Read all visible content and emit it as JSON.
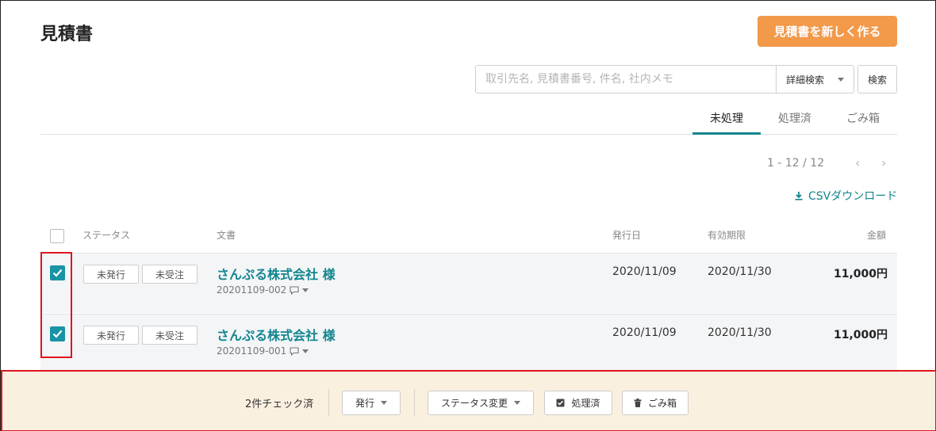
{
  "page": {
    "title": "見積書"
  },
  "toolbar": {
    "new_label": "見積書を新しく作る"
  },
  "search": {
    "placeholder": "取引先名, 見積書番号, 件名, 社内メモ",
    "advanced_label": "詳細検索",
    "button_label": "検索"
  },
  "tabs": [
    {
      "label": "未処理",
      "active": true
    },
    {
      "label": "処理済",
      "active": false
    },
    {
      "label": "ごみ箱",
      "active": false
    }
  ],
  "pagination": {
    "range": "1 - 12 / 12"
  },
  "csv": {
    "label": "CSVダウンロード"
  },
  "table": {
    "headers": {
      "status": "ステータス",
      "document": "文書",
      "issue_date": "発行日",
      "expiry": "有効期限",
      "amount": "金額"
    },
    "rows": [
      {
        "checked": true,
        "status1": "未発行",
        "status2": "未受注",
        "client": "さんぷる株式会社 様",
        "doc_no": "20201109-002",
        "issue_date": "2020/11/09",
        "expiry": "2020/11/30",
        "amount": "11,000円"
      },
      {
        "checked": true,
        "status1": "未発行",
        "status2": "未受注",
        "client": "さんぷる株式会社 様",
        "doc_no": "20201109-001",
        "issue_date": "2020/11/09",
        "expiry": "2020/11/30",
        "amount": "11,000円"
      }
    ]
  },
  "bulk_bar": {
    "count_text": "2件チェック済",
    "issue_label": "発行",
    "status_change_label": "ステータス変更",
    "processed_label": "処理済",
    "trash_label": "ごみ箱"
  },
  "colors": {
    "accent": "#12868f",
    "primary_button": "#f2994a",
    "checkbox": "#1794a5",
    "highlight": "#e0141e",
    "bar_bg": "#faf0df"
  }
}
